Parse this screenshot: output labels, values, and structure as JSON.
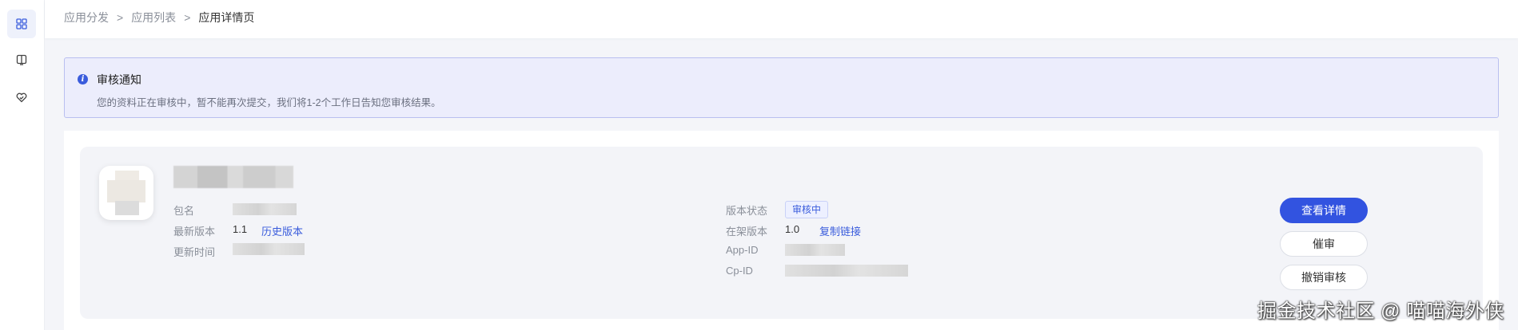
{
  "sidebar": {
    "items": [
      {
        "icon": "grid-icon",
        "active": true
      },
      {
        "icon": "book-icon",
        "active": false
      },
      {
        "icon": "heart-shield-icon",
        "active": false
      }
    ]
  },
  "breadcrumb": {
    "items": [
      "应用分发",
      "应用列表"
    ],
    "separator": ">",
    "current": "应用详情页"
  },
  "notice": {
    "icon": "info-icon",
    "icon_glyph": "i",
    "title": "审核通知",
    "text": "您的资料正在审核中，暂不能再次提交，我们将1-2个工作日告知您审核结果。"
  },
  "app": {
    "left_fields": {
      "package_label": "包名",
      "latest_version_label": "最新版本",
      "latest_version_value": "1.1",
      "history_link": "历史版本",
      "updated_label": "更新时间"
    },
    "right_fields": {
      "status_label": "版本状态",
      "status_value": "审核中",
      "shelf_version_label": "在架版本",
      "shelf_version_value": "1.0",
      "copy_link": "复制链接",
      "app_id_label": "App-ID",
      "cp_id_label": "Cp-ID"
    },
    "actions": {
      "view_details": "查看详情",
      "urge_review": "催审",
      "cancel_review": "撤销审核"
    }
  },
  "colors": {
    "primary": "#3253e0",
    "notice_bg": "#ecedfc",
    "card_bg": "#f3f4f8"
  },
  "watermark": "掘金技术社区 @ 喵喵海外侠"
}
